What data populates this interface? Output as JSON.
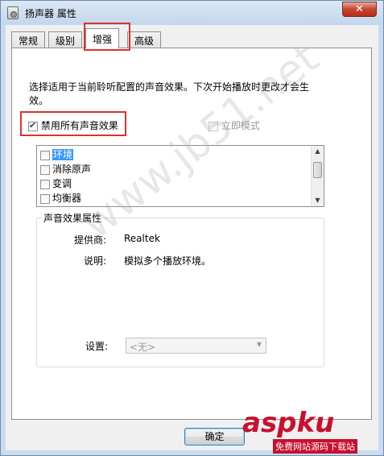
{
  "window": {
    "title": "扬声器 属性",
    "close_glyph": "✕"
  },
  "tabs": [
    {
      "label": "常规",
      "active": false
    },
    {
      "label": "级别",
      "active": false
    },
    {
      "label": "增强",
      "active": true
    },
    {
      "label": "高级",
      "active": false
    }
  ],
  "enhancements": {
    "description_line1": "选择适用于当前聆听配置的声音效果。下次开始播放时更改才会生",
    "description_line2": "效。",
    "disable_all_label": "禁用所有声音效果",
    "disable_all_checked": true,
    "immediate_mode_label": "立即模式",
    "immediate_mode_checked": false,
    "effects": [
      {
        "label": "环境",
        "checked": false,
        "selected": true
      },
      {
        "label": "消除原声",
        "checked": false,
        "selected": false
      },
      {
        "label": "变调",
        "checked": false,
        "selected": false
      },
      {
        "label": "均衡器",
        "checked": false,
        "selected": false
      }
    ]
  },
  "properties": {
    "group_title": "声音效果属性",
    "provider_label": "提供商:",
    "provider_value": "Realtek",
    "description_label": "说明:",
    "description_value": "模拟多个播放环境。",
    "settings_label": "设置:",
    "settings_value": "<无>"
  },
  "buttons": {
    "ok": "确定"
  },
  "overlay": {
    "watermark": "www.jb51.net",
    "logo_main": "aspku",
    "logo_sub": "免费网站源码下载站"
  },
  "colors": {
    "highlight_box": "#d9342c",
    "selection": "#3399ff",
    "close_button": "#c7442f"
  }
}
